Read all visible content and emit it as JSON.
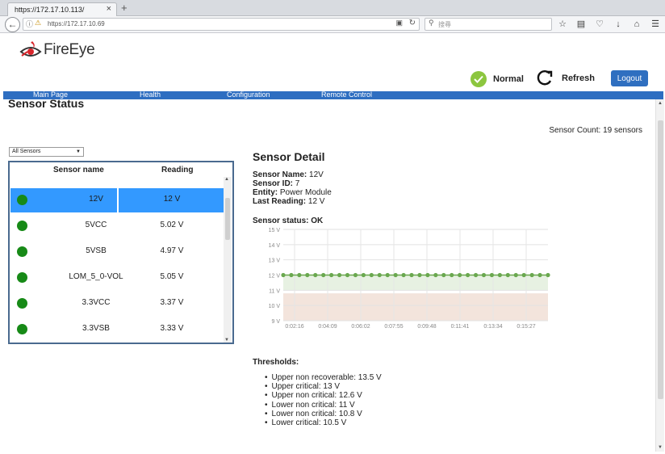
{
  "browser": {
    "tab_title": "https://172.17.10.113/",
    "tab_close": "×",
    "new_tab": "+",
    "url": "https://172.17.10.69",
    "search_placeholder": "搜尋"
  },
  "header": {
    "logo_text": "FireEye",
    "status_label": "Normal",
    "refresh_label": "Refresh",
    "logout_label": "Logout"
  },
  "nav": {
    "items": [
      "Main Page",
      "Health",
      "Configuration",
      "Remote Control"
    ]
  },
  "page": {
    "title": "Sensor Status",
    "sensor_count_label": "Sensor Count:",
    "sensor_count_value": "19 sensors",
    "filter_value": "All Sensors"
  },
  "table": {
    "headers": [
      "Sensor name",
      "Reading"
    ],
    "rows": [
      {
        "name": "12V",
        "reading": "12 V",
        "status_color": "#178a17",
        "selected": true
      },
      {
        "name": "5VCC",
        "reading": "5.02 V",
        "status_color": "#178a17",
        "selected": false
      },
      {
        "name": "5VSB",
        "reading": "4.97 V",
        "status_color": "#178a17",
        "selected": false
      },
      {
        "name": "LOM_5_0-VOL",
        "reading": "5.05 V",
        "status_color": "#178a17",
        "selected": false
      },
      {
        "name": "3.3VCC",
        "reading": "3.37 V",
        "status_color": "#178a17",
        "selected": false
      },
      {
        "name": "3.3VSB",
        "reading": "3.33 V",
        "status_color": "#178a17",
        "selected": false
      }
    ]
  },
  "detail": {
    "title": "Sensor Detail",
    "name_label": "Sensor Name:",
    "name_value": "12V",
    "id_label": "Sensor ID:",
    "id_value": "7",
    "entity_label": "Entity:",
    "entity_value": "Power Module",
    "last_label": "Last Reading:",
    "last_value": "12 V",
    "status_text": "Sensor status: OK"
  },
  "chart_data": {
    "type": "line",
    "title": "",
    "xlabel": "",
    "ylabel": "",
    "ylim": [
      9,
      15
    ],
    "yticks": [
      "9 V",
      "10 V",
      "11 V",
      "12 V",
      "13 V",
      "14 V",
      "15 V"
    ],
    "xticks": [
      "0:02:16",
      "0:04:09",
      "0:06:02",
      "0:07:55",
      "0:09:48",
      "0:11:41",
      "0:13:34",
      "0:15:27"
    ],
    "series": [
      {
        "values": [
          12,
          12,
          12,
          12,
          12,
          12,
          12,
          12,
          12,
          12,
          12,
          12,
          12,
          12,
          12,
          12,
          12,
          12,
          12,
          12,
          12,
          12,
          12,
          12,
          12,
          12,
          12,
          12,
          12,
          12,
          12,
          12,
          12,
          12
        ]
      }
    ],
    "bands": [
      {
        "from": 11,
        "to": 12,
        "color": "#e7f1e2"
      },
      {
        "from": 9,
        "to": 10.8,
        "color": "#f3e4dc"
      }
    ],
    "grid": true,
    "line_color": "#6aa84f"
  },
  "thresholds": {
    "title": "Thresholds:",
    "items": [
      "Upper non recoverable: 13.5 V",
      "Upper critical: 13 V",
      "Upper non critical: 12.6 V",
      "Lower non critical: 11 V",
      "Lower non critical: 10.8 V",
      "Lower critical: 10.5 V"
    ]
  }
}
